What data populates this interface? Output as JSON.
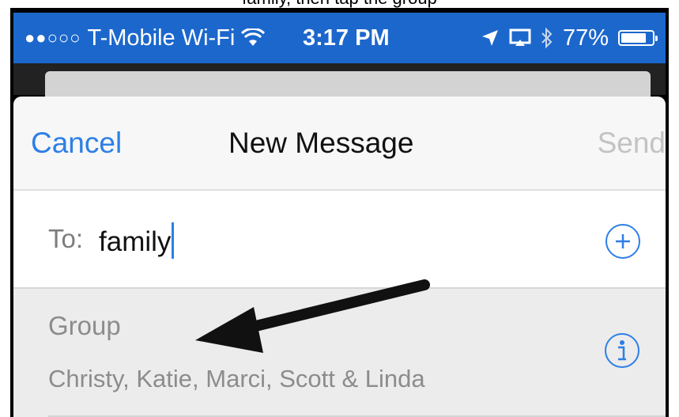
{
  "caption": "family, then tap the group",
  "status_bar": {
    "carrier": "T-Mobile Wi-Fi",
    "time": "3:17 PM",
    "battery": "77%",
    "battery_level": 0.77,
    "icons": [
      "signal-dots-icon",
      "wifi-icon",
      "location-icon",
      "airplay-icon",
      "bluetooth-icon",
      "battery-icon"
    ]
  },
  "nav": {
    "cancel_label": "Cancel",
    "title": "New Message",
    "send_label": "Send"
  },
  "to_field": {
    "label": "To:",
    "value": "family",
    "add_icon": "plus-circle-icon"
  },
  "suggestion": {
    "title": "Group",
    "members": "Christy, Katie, Marci, Scott & Linda",
    "info_icon": "info-circle-icon"
  },
  "annotation": {
    "arrow_icon": "arrow-annotation-icon",
    "color": "#111111"
  },
  "colors": {
    "status_bar": "#1c67cc",
    "accent": "#2d7fe6",
    "sheet": "#f7f7f7",
    "suggestion_bg": "#ececec"
  }
}
